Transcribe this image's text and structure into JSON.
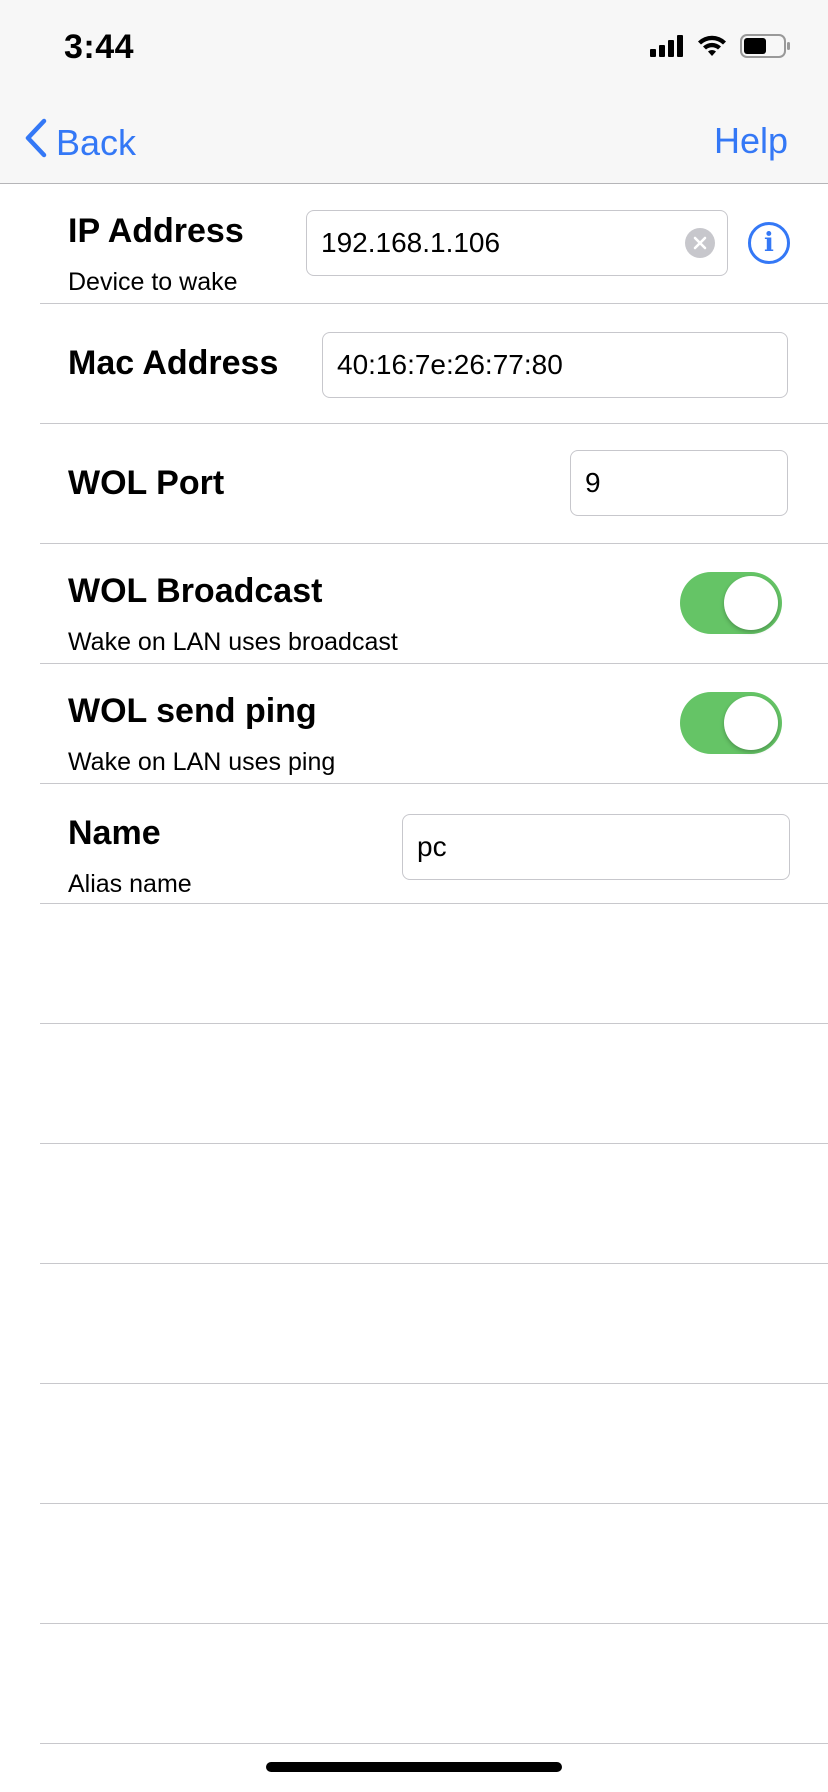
{
  "status_bar": {
    "time": "3:44",
    "icons": [
      "cellular-signal-icon",
      "wifi-icon",
      "battery-icon"
    ]
  },
  "nav": {
    "back_label": "Back",
    "help_label": "Help",
    "back_icon": "chevron-left-icon",
    "accent_color": "#3478f6"
  },
  "rows": {
    "ip": {
      "title": "IP Address",
      "subtitle": "Device to wake",
      "value": "192.168.1.106"
    },
    "mac": {
      "title": "Mac Address",
      "value": "40:16:7e:26:77:80"
    },
    "port": {
      "title": "WOL Port",
      "value": "9"
    },
    "broadcast": {
      "title": "WOL Broadcast",
      "subtitle": "Wake on LAN uses broadcast",
      "on": true
    },
    "ping": {
      "title": "WOL send ping",
      "subtitle": "Wake on LAN uses ping",
      "on": true
    },
    "name": {
      "title": "Name",
      "subtitle": "Alias name",
      "value": "pc"
    }
  },
  "colors": {
    "toggle_on": "#65c466",
    "separator": "#c8c8cc",
    "header_bg": "#f7f7f7"
  }
}
